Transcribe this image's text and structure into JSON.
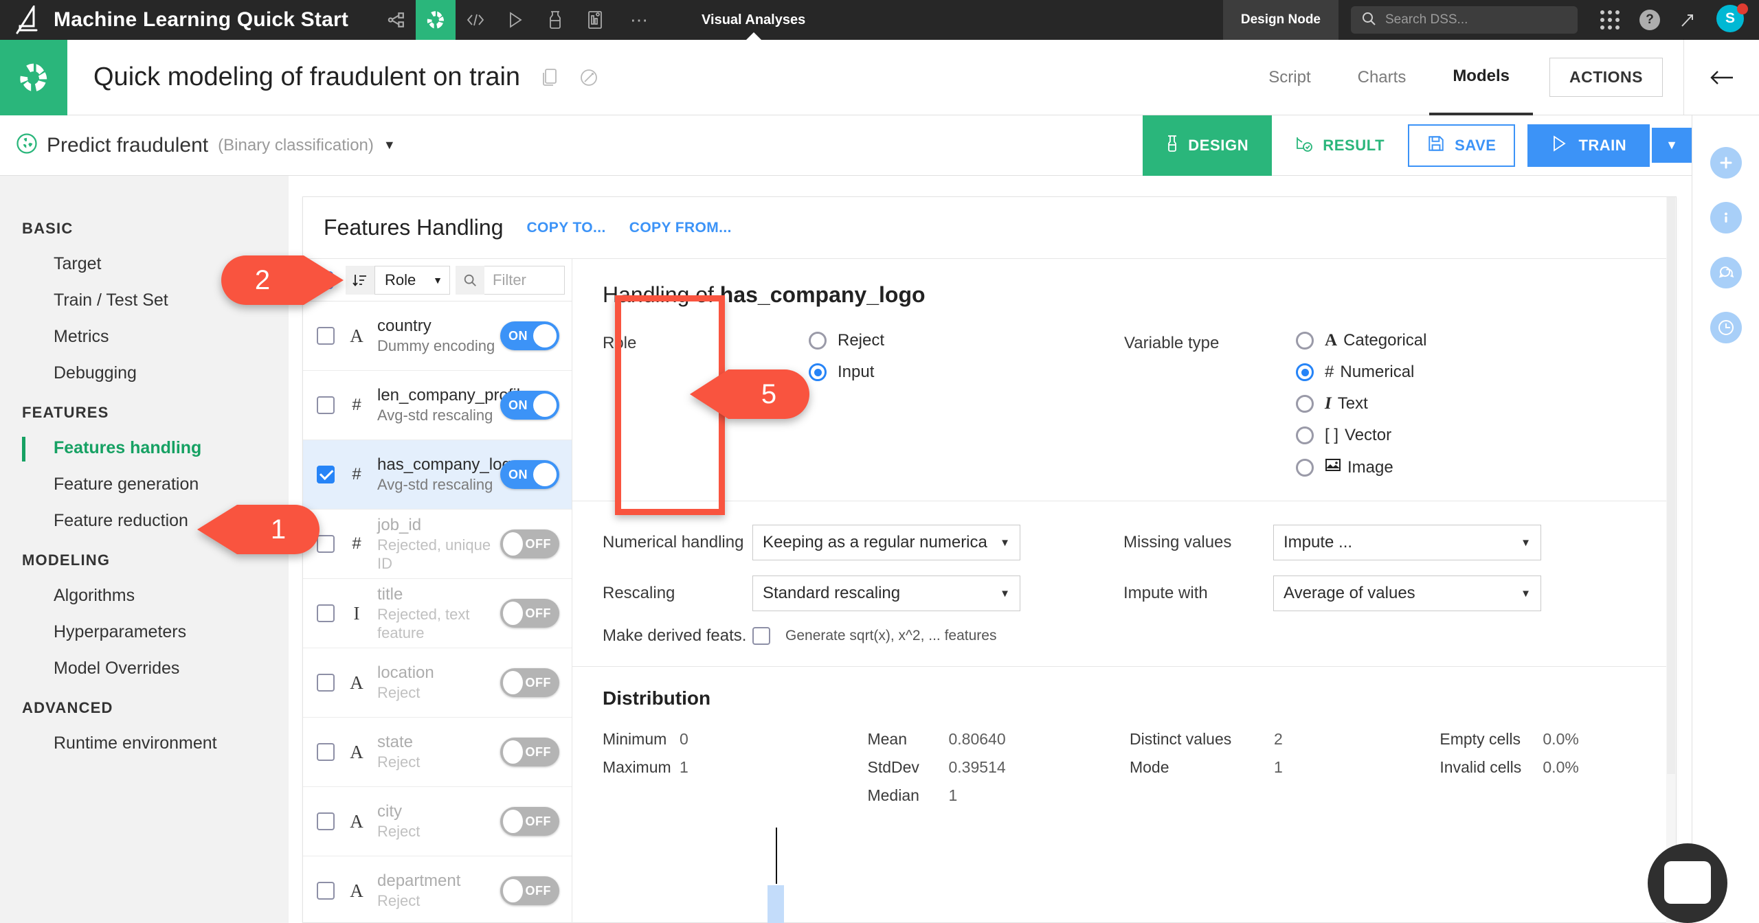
{
  "topbar": {
    "project_title": "Machine Learning Quick Start",
    "icons": [
      "flow-icon",
      "lab-icon",
      "code-icon",
      "play-icon",
      "jobs-icon",
      "dashboard-icon",
      "more-icon"
    ],
    "section_label": "Visual Analyses",
    "node_label": "Design Node",
    "search_placeholder": "Search DSS...",
    "search_value": "",
    "apps_icon": "grid-apps-icon",
    "help_icon": "help-icon",
    "trend_icon": "trending-up-icon",
    "avatar_initial": "S"
  },
  "header": {
    "analysis_title": "Quick modeling of fraudulent on train",
    "copy_icon": "duplicate-icon",
    "share_icon": "sharing-icon",
    "tabs": [
      {
        "label": "Script",
        "active": false
      },
      {
        "label": "Charts",
        "active": false
      },
      {
        "label": "Models",
        "active": true
      }
    ],
    "actions_label": "ACTIONS",
    "back_icon": "arrow-left-icon"
  },
  "toolbar": {
    "target_name": "Predict fraudulent",
    "target_type": "(Binary classification)",
    "target_caret": "▼",
    "design_label": "DESIGN",
    "result_label": "RESULT",
    "save_label": "SAVE",
    "train_label": "TRAIN",
    "train_caret": "▼"
  },
  "rail": {
    "items": [
      {
        "icon": "plus-icon",
        "glyph": "+"
      },
      {
        "icon": "info-icon",
        "glyph": "i"
      },
      {
        "icon": "discussions-icon",
        "glyph": "⚇"
      },
      {
        "icon": "history-icon",
        "glyph": "◴"
      }
    ]
  },
  "sidebar": {
    "groups": [
      {
        "title": "BASIC",
        "items": [
          {
            "label": "Target",
            "active": false
          },
          {
            "label": "Train / Test Set",
            "active": false
          },
          {
            "label": "Metrics",
            "active": false
          },
          {
            "label": "Debugging",
            "active": false
          }
        ]
      },
      {
        "title": "FEATURES",
        "items": [
          {
            "label": "Features handling",
            "active": true
          },
          {
            "label": "Feature generation",
            "active": false
          },
          {
            "label": "Feature reduction",
            "active": false
          }
        ]
      },
      {
        "title": "MODELING",
        "items": [
          {
            "label": "Algorithms",
            "active": false
          },
          {
            "label": "Hyperparameters",
            "active": false
          },
          {
            "label": "Model Overrides",
            "active": false
          }
        ]
      },
      {
        "title": "ADVANCED",
        "items": [
          {
            "label": "Runtime environment",
            "active": false
          }
        ]
      }
    ]
  },
  "panel": {
    "title": "Features Handling",
    "copy_to": "COPY TO...",
    "copy_from": "COPY FROM...",
    "select_all_state": "indeterminate",
    "sort_icon": "sort-icon",
    "sort_by": "Role",
    "sort_caret": "▼",
    "search_icon": "search-icon",
    "filter_placeholder": "Filter",
    "filter_value": ""
  },
  "features": [
    {
      "name": "country",
      "type_glyph": "A",
      "type": "categorical",
      "desc": "Dummy encoding",
      "checked": false,
      "toggle": "ON",
      "selected": false
    },
    {
      "name": "len_company_profile",
      "type_glyph": "#",
      "type": "numerical",
      "desc": "Avg-std rescaling",
      "checked": false,
      "toggle": "ON",
      "selected": false
    },
    {
      "name": "has_company_logo",
      "type_glyph": "#",
      "type": "numerical",
      "desc": "Avg-std rescaling",
      "checked": true,
      "toggle": "ON",
      "selected": true
    },
    {
      "name": "job_id",
      "type_glyph": "#",
      "type": "numerical",
      "desc": "Rejected, unique ID",
      "checked": false,
      "toggle": "OFF",
      "selected": false
    },
    {
      "name": "title",
      "type_glyph": "I",
      "type": "text",
      "desc": "Rejected, text feature",
      "checked": false,
      "toggle": "OFF",
      "selected": false
    },
    {
      "name": "location",
      "type_glyph": "A",
      "type": "categorical",
      "desc": "Reject",
      "checked": false,
      "toggle": "OFF",
      "selected": false
    },
    {
      "name": "state",
      "type_glyph": "A",
      "type": "categorical",
      "desc": "Reject",
      "checked": false,
      "toggle": "OFF",
      "selected": false
    },
    {
      "name": "city",
      "type_glyph": "A",
      "type": "categorical",
      "desc": "Reject",
      "checked": false,
      "toggle": "OFF",
      "selected": false
    },
    {
      "name": "department",
      "type_glyph": "A",
      "type": "categorical",
      "desc": "Reject",
      "checked": false,
      "toggle": "OFF",
      "selected": false
    }
  ],
  "detail": {
    "heading_prefix": "Handling of ",
    "heading_feature": "has_company_logo",
    "role_label": "Role",
    "role_options": [
      {
        "label": "Reject",
        "selected": false
      },
      {
        "label": "Input",
        "selected": true
      }
    ],
    "vartype_label": "Variable type",
    "vartype_options": [
      {
        "glyph": "A",
        "label": "Categorical",
        "selected": false
      },
      {
        "glyph": "#",
        "label": "Numerical",
        "selected": true
      },
      {
        "glyph": "I",
        "label": "Text",
        "selected": false
      },
      {
        "glyph": "[ ]",
        "label": "Vector",
        "selected": false
      },
      {
        "glyph": "Ὓc",
        "label": "Image",
        "selected": false
      }
    ],
    "numerical_handling_label": "Numerical handling",
    "numerical_handling_value": "Keeping as a regular numerica",
    "rescaling_label": "Rescaling",
    "rescaling_value": "Standard rescaling",
    "derived_label": "Make derived feats.",
    "derived_checkbox_label": "Generate sqrt(x), x^2, ... features",
    "derived_checked": false,
    "missing_values_label": "Missing values",
    "missing_values_value": "Impute ...",
    "impute_with_label": "Impute with",
    "impute_with_value": "Average of values"
  },
  "distribution": {
    "title": "Distribution",
    "col1": [
      {
        "key": "Minimum",
        "value": "0"
      },
      {
        "key": "Maximum",
        "value": "1"
      }
    ],
    "col2": [
      {
        "key": "Mean",
        "value": "0.80640"
      },
      {
        "key": "StdDev",
        "value": "0.39514"
      },
      {
        "key": "Median",
        "value": "1"
      }
    ],
    "col3": [
      {
        "key": "Distinct values",
        "value": "2"
      },
      {
        "key": "Mode",
        "value": "1"
      }
    ],
    "col4": [
      {
        "key": "Empty cells",
        "value": "0.0%"
      },
      {
        "key": "Invalid cells",
        "value": "0.0%"
      }
    ]
  },
  "callouts": [
    {
      "id": 1,
      "label": "1"
    },
    {
      "id": 2,
      "label": "2"
    },
    {
      "id": 5,
      "label": "5"
    }
  ],
  "chat": {
    "icon": "chat-bubble-icon"
  },
  "colors": {
    "green": "#2ab67b",
    "blue": "#3c93f7",
    "dark": "#272727",
    "callout": "#f9543f"
  }
}
